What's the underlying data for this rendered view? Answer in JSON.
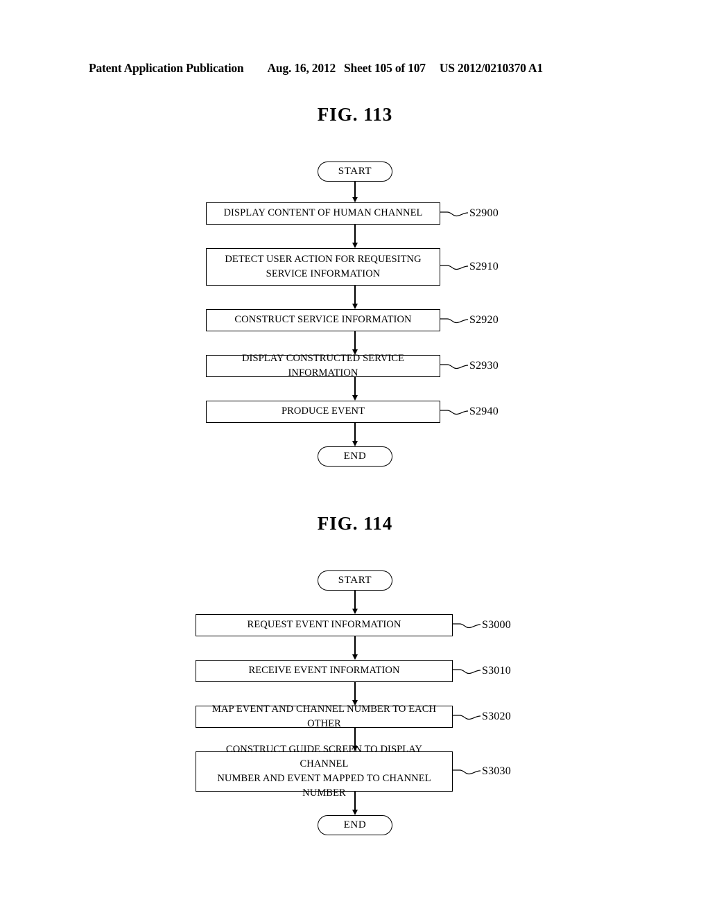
{
  "header": {
    "publication": "Patent Application Publication",
    "date": "Aug. 16, 2012",
    "sheet": "Sheet 105 of 107",
    "number": "US 2012/0210370 A1"
  },
  "figures": [
    {
      "title": "FIG. 113",
      "start_label": "START",
      "end_label": "END",
      "steps": [
        {
          "text": "DISPLAY CONTENT OF HUMAN CHANNEL",
          "label": "S2900",
          "lines": 1
        },
        {
          "line1": "DETECT USER ACTION FOR REQUESITNG",
          "line2": "SERVICE INFORMATION",
          "label": "S2910",
          "lines": 2
        },
        {
          "text": "CONSTRUCT SERVICE INFORMATION",
          "label": "S2920",
          "lines": 1
        },
        {
          "text": "DISPLAY CONSTRUCTED SERVICE INFORMATION",
          "label": "S2930",
          "lines": 1
        },
        {
          "text": "PRODUCE EVENT",
          "label": "S2940",
          "lines": 1
        }
      ]
    },
    {
      "title": "FIG. 114",
      "start_label": "START",
      "end_label": "END",
      "steps": [
        {
          "text": "REQUEST EVENT INFORMATION",
          "label": "S3000",
          "lines": 1
        },
        {
          "text": "RECEIVE EVENT INFORMATION",
          "label": "S3010",
          "lines": 1
        },
        {
          "text": "MAP EVENT AND CHANNEL NUMBER TO EACH OTHER",
          "label": "S3020",
          "lines": 1
        },
        {
          "line1": "CONSTRUCT GUIDE SCREEN TO DISPLAY CHANNEL",
          "line2": "NUMBER AND EVENT MAPPED TO CHANNEL NUMBER",
          "label": "S3030",
          "lines": 2
        }
      ]
    }
  ]
}
